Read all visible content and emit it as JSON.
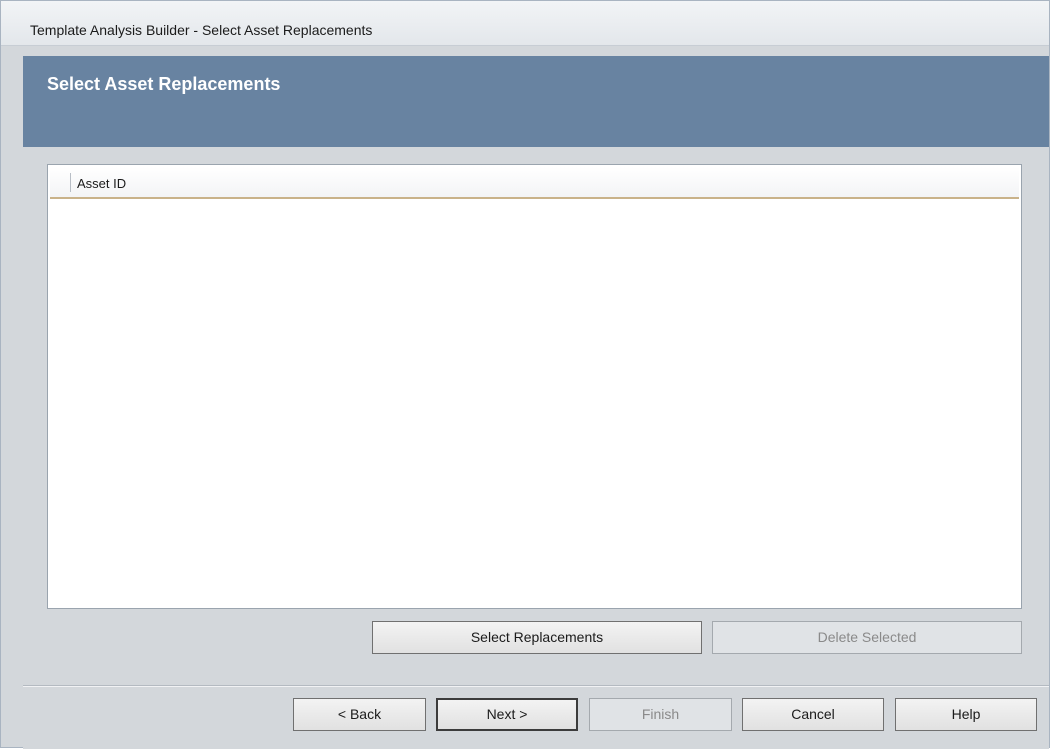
{
  "window": {
    "title": "Template Analysis Builder - Select Asset Replacements"
  },
  "header": {
    "title": "Select Asset Replacements"
  },
  "grid": {
    "columns": [
      "Asset ID"
    ],
    "rows": []
  },
  "actions": {
    "select_replacements": "Select Replacements",
    "delete_selected": "Delete Selected"
  },
  "footer": {
    "back": "< Back",
    "next": "Next >",
    "finish": "Finish",
    "cancel": "Cancel",
    "help": "Help"
  }
}
